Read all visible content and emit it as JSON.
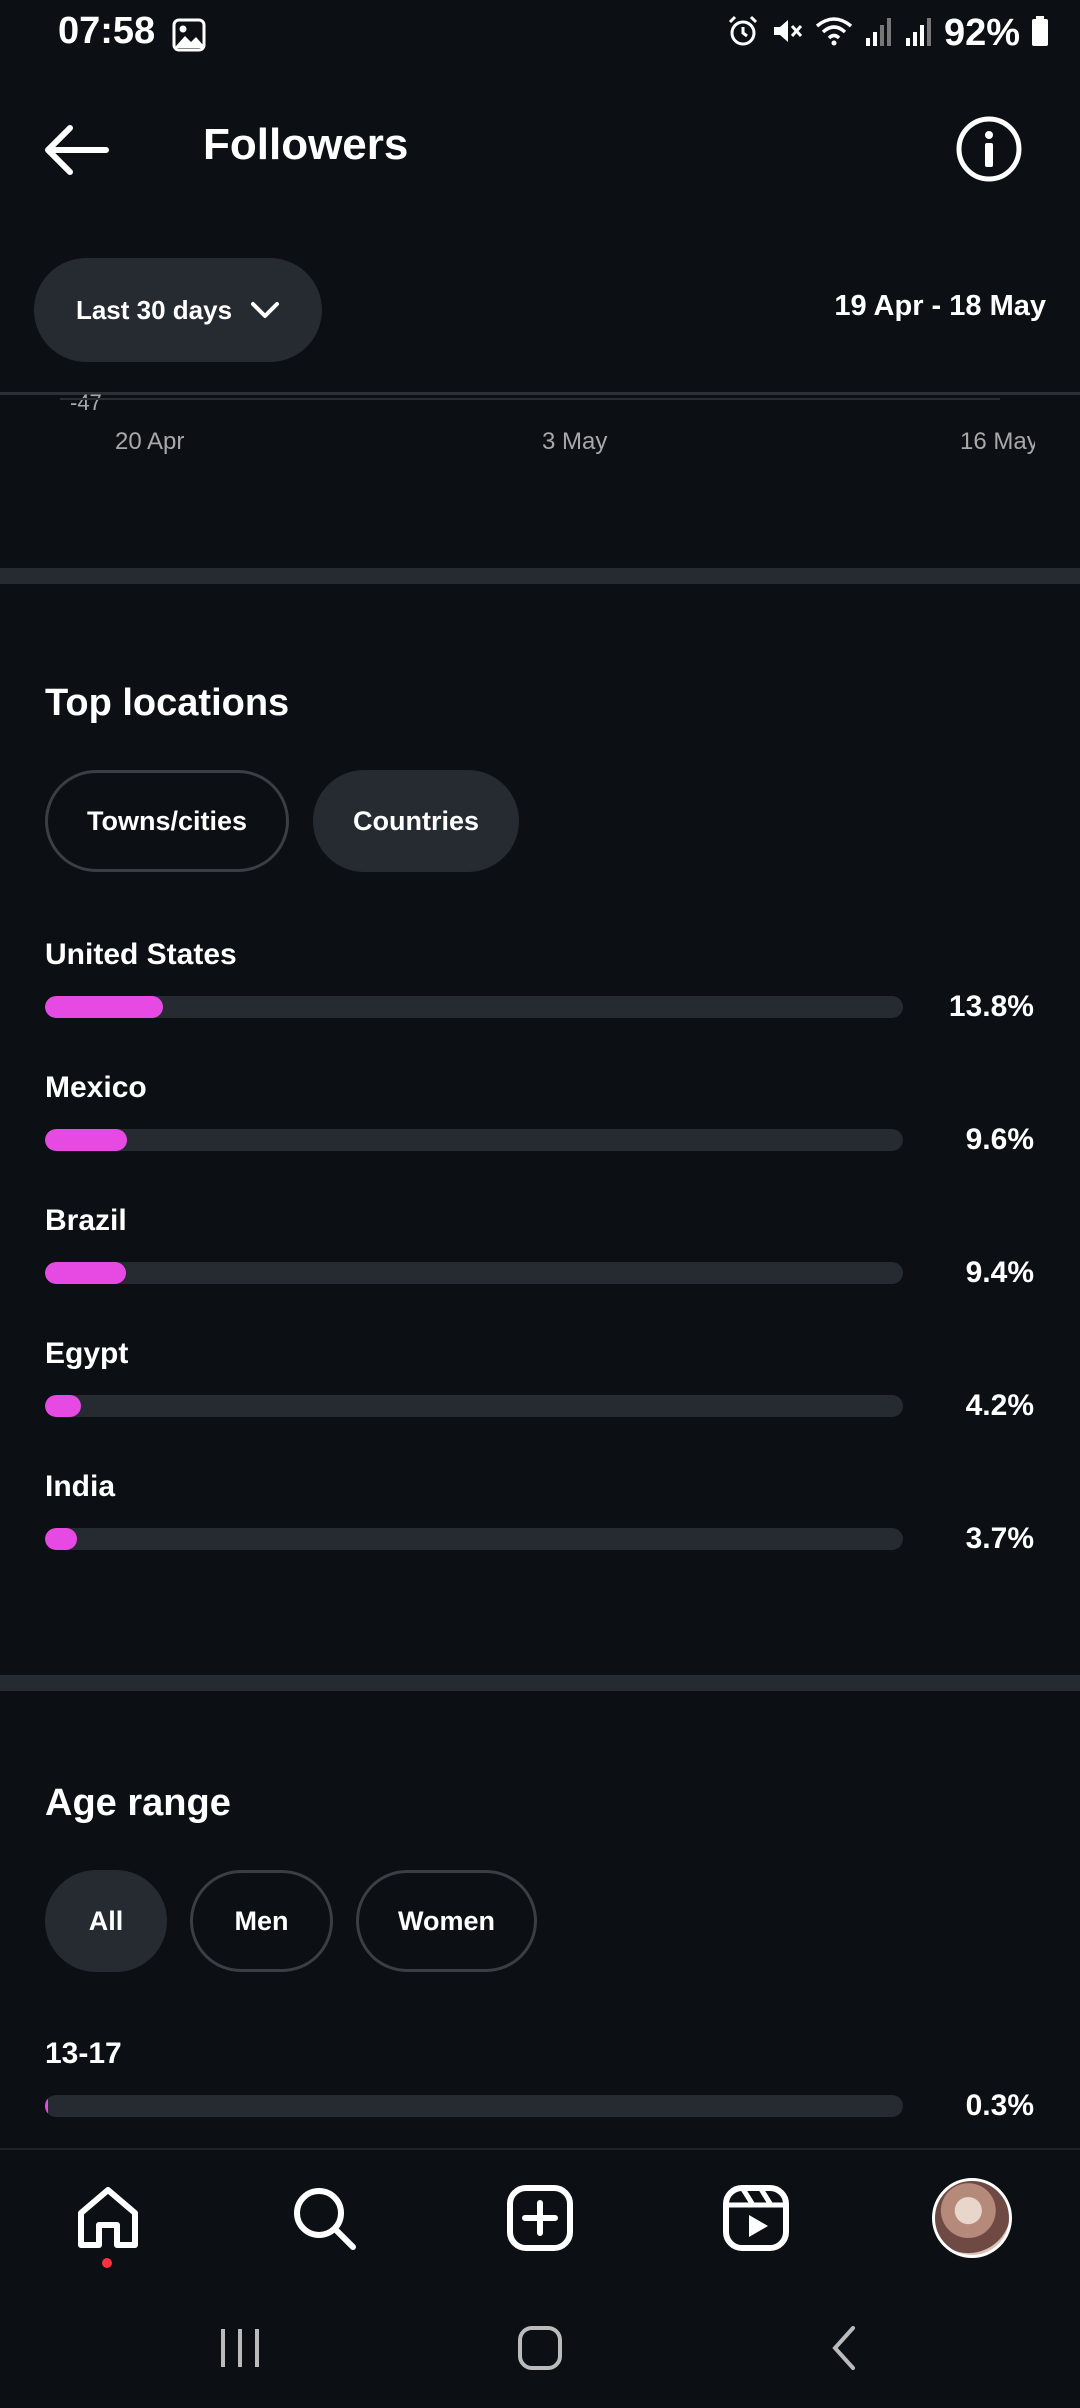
{
  "status_bar": {
    "time": "07:58",
    "battery": "92%"
  },
  "header": {
    "title": "Followers"
  },
  "date_filter": {
    "selected": "Last 30 days",
    "range": "19 Apr - 18 May"
  },
  "chart_stub": {
    "y_label": "-47",
    "x_labels": [
      "20 Apr",
      "3 May",
      "16 May"
    ]
  },
  "top_locations": {
    "title": "Top locations",
    "tabs": [
      {
        "label": "Towns/cities",
        "selected": false
      },
      {
        "label": "Countries",
        "selected": true
      }
    ],
    "rows": [
      {
        "label": "United States",
        "value": "13.8%",
        "fraction": 0.138
      },
      {
        "label": "Mexico",
        "value": "9.6%",
        "fraction": 0.096
      },
      {
        "label": "Brazil",
        "value": "9.4%",
        "fraction": 0.094
      },
      {
        "label": "Egypt",
        "value": "4.2%",
        "fraction": 0.042
      },
      {
        "label": "India",
        "value": "3.7%",
        "fraction": 0.037
      }
    ]
  },
  "age_range": {
    "title": "Age range",
    "tabs": [
      {
        "label": "All",
        "selected": true
      },
      {
        "label": "Men",
        "selected": false
      },
      {
        "label": "Women",
        "selected": false
      }
    ],
    "rows": [
      {
        "label": "13-17",
        "value": "0.3%",
        "fraction": 0.003
      }
    ]
  },
  "colors": {
    "background": "#0c1014",
    "bar_fill": "#e749e3",
    "bar_track": "#262a31",
    "notification_dot": "#ff3040"
  },
  "icons": {
    "status_left": "image-icon",
    "status_right": [
      "alarm-icon",
      "mute-icon",
      "wifi-icon",
      "signal-icon",
      "signal-icon",
      "battery-icon"
    ],
    "bottom_nav": [
      "home-icon",
      "search-icon",
      "create-icon",
      "reels-icon",
      "profile-avatar"
    ],
    "system_nav": [
      "recents-icon",
      "home-circle-icon",
      "back-chevron-icon"
    ]
  }
}
